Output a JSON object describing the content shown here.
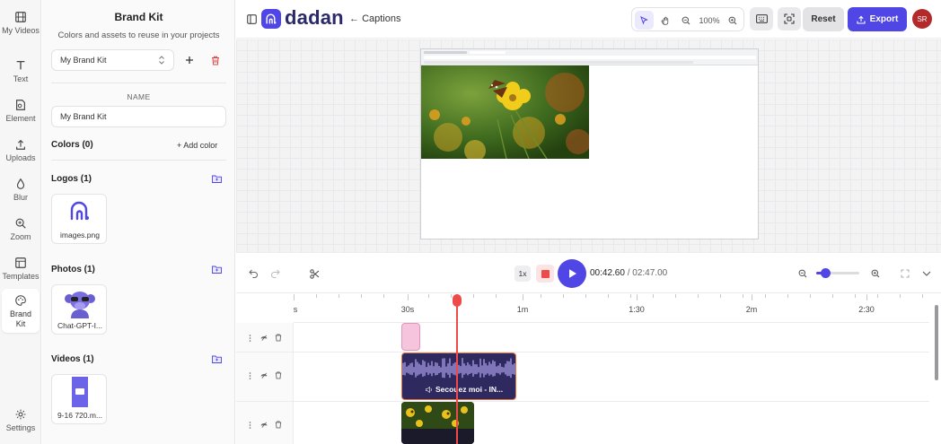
{
  "rail": {
    "items": [
      {
        "label": "My Videos",
        "icon": "film-icon"
      },
      {
        "label": "Text",
        "icon": "text-icon"
      },
      {
        "label": "Element",
        "icon": "element-icon"
      },
      {
        "label": "Uploads",
        "icon": "upload-icon"
      },
      {
        "label": "Blur",
        "icon": "droplet-icon"
      },
      {
        "label": "Zoom",
        "icon": "zoom-icon"
      },
      {
        "label": "Templates",
        "icon": "templates-icon"
      },
      {
        "label": "Brand Kit",
        "icon": "palette-icon"
      },
      {
        "label": "Settings",
        "icon": "gear-icon"
      }
    ]
  },
  "panel": {
    "title": "Brand Kit",
    "subtitle": "Colors and assets to reuse in your projects",
    "kit_selected": "My Brand Kit",
    "name_label": "NAME",
    "name_value": "My Brand Kit",
    "colors_heading": "Colors (0)",
    "add_color": "+ Add color",
    "logos_heading": "Logos (1)",
    "logo_file": "images.png",
    "photos_heading": "Photos (1)",
    "photo_file": "Chat-GPT-I...",
    "videos_heading": "Videos (1)",
    "video_file": "9-16 720.m..."
  },
  "header": {
    "brand": "dadan",
    "back_label": "Captions",
    "zoom_level": "100%",
    "reset_label": "Reset",
    "export_label": "Export",
    "avatar_initials": "SR"
  },
  "playback": {
    "speed": "1x",
    "current_time": "00:42.60",
    "separator": " / ",
    "duration": "02:47.00",
    "zoom_fraction": 0.2
  },
  "timeline": {
    "ruler_labels": [
      "s",
      "30s",
      "1m",
      "1:30",
      "2m",
      "2:30"
    ],
    "audio_clip_label": "Secouez moi - IN..."
  },
  "colors": {
    "accent": "#4f46e5",
    "playhead": "#ef4a4a",
    "avatar": "#b32a2a"
  }
}
